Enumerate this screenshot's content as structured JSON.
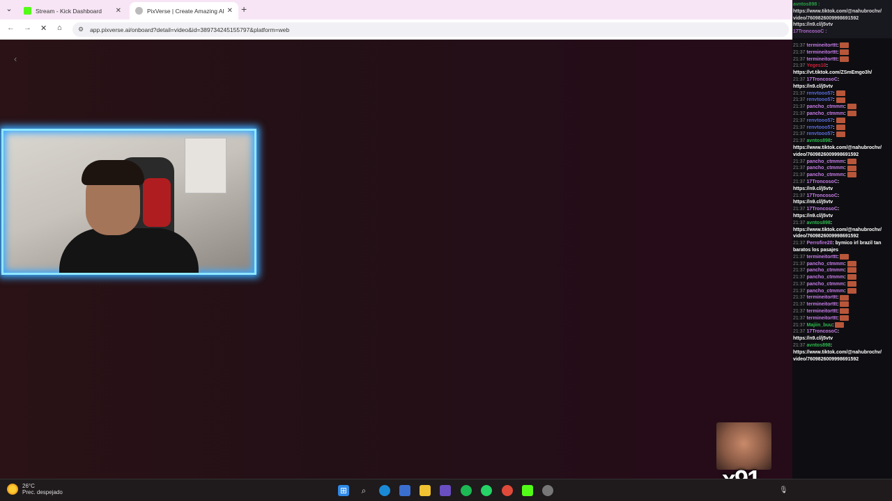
{
  "browser": {
    "tabs": [
      {
        "title": "Stream - Kick Dashboard",
        "close": "✕"
      },
      {
        "title": "PixVerse | Create Amazing AI V",
        "close": "✕"
      }
    ],
    "new_tab": "+",
    "url": "app.pixverse.ai/onboard?detail=video&id=389734245155797&platform=web",
    "nav": {
      "back": "←",
      "forward": "→",
      "stop": "✕",
      "home": "⌂",
      "tune": "⚙",
      "menu": "⋮"
    }
  },
  "page": {
    "back_glyph": "‹"
  },
  "chat": {
    "header_lines": [
      "avntos898 :",
      "https://www.tiktok.com/@nahubrochv/",
      "video/7609826009998691592",
      "https://n9.cl/j5vtv",
      "17TroncosoC :"
    ],
    "messages": [
      {
        "ts": "21:37",
        "user": "termineitorttt",
        "color": "#c67be6",
        "text": ":",
        "emote": true
      },
      {
        "ts": "21:37",
        "user": "termineitorttt",
        "color": "#c67be6",
        "text": ":",
        "emote": true
      },
      {
        "ts": "21:37",
        "user": "termineitorttt",
        "color": "#c67be6",
        "text": ":",
        "emote": true
      },
      {
        "ts": "21:37",
        "user": "Yeges10",
        "color": "#d0203a",
        "text": ":"
      },
      {
        "ts": "",
        "user": "",
        "color": "#fff",
        "text": "https://vt.tiktok.com/ZSmEmgo3h/"
      },
      {
        "ts": "21:37",
        "user": "17TroncosoC",
        "color": "#c67be6",
        "text": ":"
      },
      {
        "ts": "",
        "user": "",
        "color": "#fff",
        "text": "https://n9.cl/j5vtv"
      },
      {
        "ts": "21:37",
        "user": "renvtooo57",
        "color": "#5a6cd6",
        "text": ":",
        "emote": true
      },
      {
        "ts": "21:37",
        "user": "renvtooo57",
        "color": "#5a6cd6",
        "text": ":",
        "emote": true
      },
      {
        "ts": "21:37",
        "user": "pancho_ctmmm",
        "color": "#c67be6",
        "text": ":",
        "emote": true
      },
      {
        "ts": "21:37",
        "user": "pancho_ctmmm",
        "color": "#c67be6",
        "text": ":",
        "emote": true
      },
      {
        "ts": "21:37",
        "user": "renvtooo57",
        "color": "#5a6cd6",
        "text": ":",
        "emote": true
      },
      {
        "ts": "21:37",
        "user": "renvtooo57",
        "color": "#5a6cd6",
        "text": ":",
        "emote": true
      },
      {
        "ts": "21:37",
        "user": "renvtooo57",
        "color": "#5a6cd6",
        "text": ":",
        "emote": true
      },
      {
        "ts": "21:37",
        "user": "avntos898",
        "color": "#2dba4e",
        "text": ":"
      },
      {
        "ts": "",
        "user": "",
        "color": "#fff",
        "text": "https://www.tiktok.com/@nahubrochv/"
      },
      {
        "ts": "",
        "user": "",
        "color": "#fff",
        "text": "video/7609826009998691592"
      },
      {
        "ts": "21:37",
        "user": "pancho_ctmmm",
        "color": "#c67be6",
        "text": ":",
        "emote": true
      },
      {
        "ts": "21:37",
        "user": "pancho_ctmmm",
        "color": "#c67be6",
        "text": ":",
        "emote": true
      },
      {
        "ts": "21:37",
        "user": "pancho_ctmmm",
        "color": "#c67be6",
        "text": ":",
        "emote": true
      },
      {
        "ts": "21:37",
        "user": "17TroncosoC",
        "color": "#c67be6",
        "text": ":"
      },
      {
        "ts": "",
        "user": "",
        "color": "#fff",
        "text": "https://n9.cl/j5vtv"
      },
      {
        "ts": "21:37",
        "user": "17TroncosoC",
        "color": "#c67be6",
        "text": ":"
      },
      {
        "ts": "",
        "user": "",
        "color": "#fff",
        "text": "https://n9.cl/j5vtv"
      },
      {
        "ts": "21:37",
        "user": "17TroncosoC",
        "color": "#c67be6",
        "text": ":"
      },
      {
        "ts": "",
        "user": "",
        "color": "#fff",
        "text": "https://n9.cl/j5vtv"
      },
      {
        "ts": "21:37",
        "user": "avntos898",
        "color": "#2dba4e",
        "text": ":"
      },
      {
        "ts": "",
        "user": "",
        "color": "#fff",
        "text": "https://www.tiktok.com/@nahubrochv/"
      },
      {
        "ts": "",
        "user": "",
        "color": "#fff",
        "text": "video/7609826009998691592"
      },
      {
        "ts": "21:37",
        "user": "Perrofire20",
        "color": "#c67be6",
        "text": ": bymico irl brazil tan"
      },
      {
        "ts": "",
        "user": "",
        "color": "#fff",
        "text": "baratos los pasajes"
      },
      {
        "ts": "21:37",
        "user": "termineitorttt",
        "color": "#c67be6",
        "text": ":",
        "emote": true
      },
      {
        "ts": "21:37",
        "user": "pancho_ctmmm",
        "color": "#c67be6",
        "text": ":",
        "emote": true
      },
      {
        "ts": "21:37",
        "user": "pancho_ctmmm",
        "color": "#c67be6",
        "text": ":",
        "emote": true
      },
      {
        "ts": "21:37",
        "user": "pancho_ctmmm",
        "color": "#c67be6",
        "text": ":",
        "emote": true
      },
      {
        "ts": "21:37",
        "user": "pancho_ctmmm",
        "color": "#c67be6",
        "text": ":",
        "emote": true
      },
      {
        "ts": "21:37",
        "user": "pancho_ctmmm",
        "color": "#c67be6",
        "text": ":",
        "emote": true
      },
      {
        "ts": "21:37",
        "user": "termineitorttt",
        "color": "#c67be6",
        "text": ":",
        "emote": true
      },
      {
        "ts": "21:37",
        "user": "termineitorttt",
        "color": "#c67be6",
        "text": ":",
        "emote": true
      },
      {
        "ts": "21:37",
        "user": "termineitorttt",
        "color": "#c67be6",
        "text": ":",
        "emote": true
      },
      {
        "ts": "21:37",
        "user": "termineitorttt",
        "color": "#c67be6",
        "text": ":",
        "emote": true
      },
      {
        "ts": "21:37",
        "user": "Majiin_buu",
        "color": "#2dba4e",
        "text": ":",
        "emote": true
      },
      {
        "ts": "21:37",
        "user": "17TroncosoC",
        "color": "#c67be6",
        "text": ":"
      },
      {
        "ts": "",
        "user": "",
        "color": "#fff",
        "text": "https://n9.cl/j5vtv"
      },
      {
        "ts": "21:37",
        "user": "avntos898",
        "color": "#2dba4e",
        "text": ":"
      },
      {
        "ts": "",
        "user": "",
        "color": "#fff",
        "text": "https://www.tiktok.com/@nahubrochv/"
      },
      {
        "ts": "",
        "user": "",
        "color": "#fff",
        "text": "video/7609826009998691592"
      }
    ]
  },
  "overlay": {
    "multiplier": "x91"
  },
  "taskbar": {
    "temp": "26°C",
    "condition": "Prec. despejado"
  }
}
